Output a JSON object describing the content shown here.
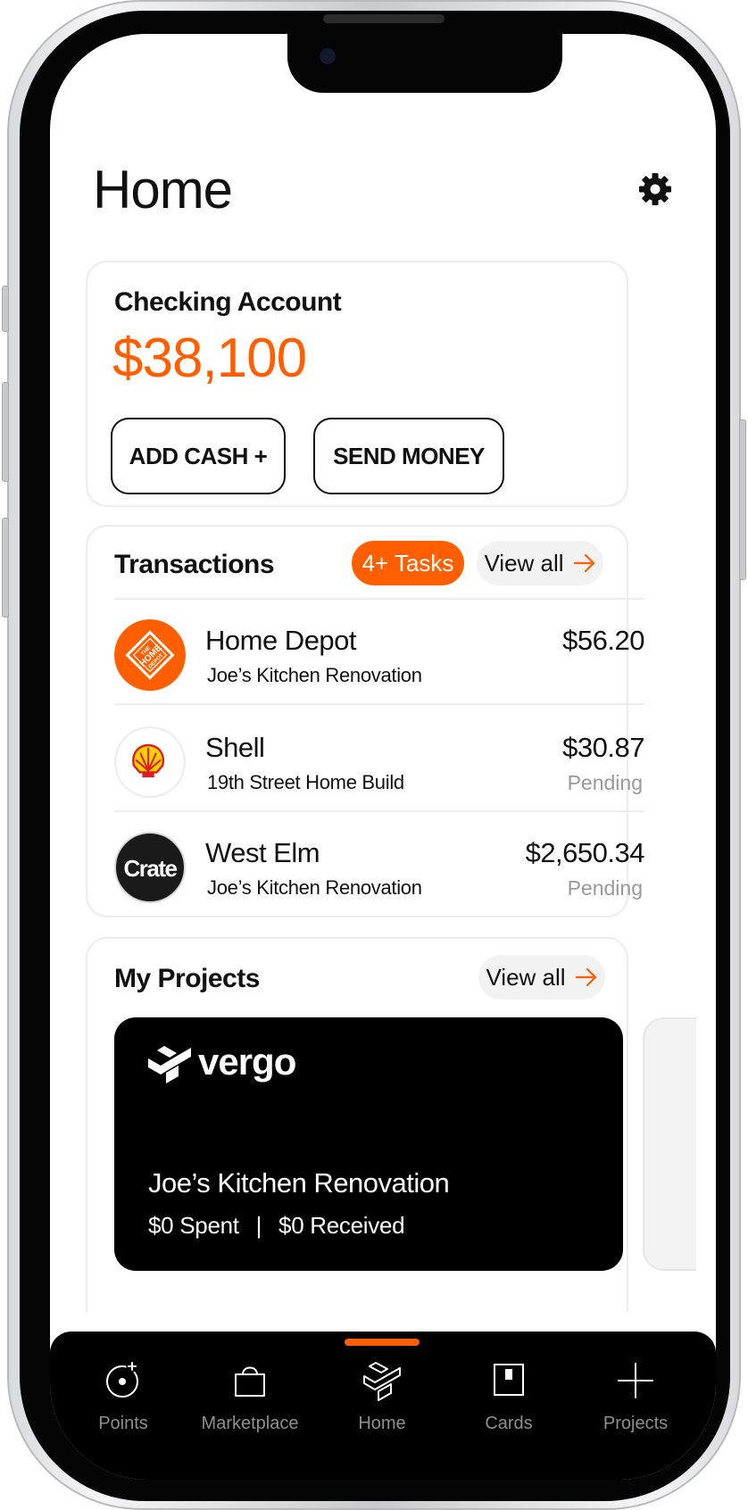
{
  "colors": {
    "accent": "#ff5f00",
    "text_primary": "#111111",
    "text_muted": "#999999",
    "card_border": "#ececec",
    "nav_bg": "#000000",
    "nav_label": "#8e8e8e"
  },
  "header": {
    "title": "Home",
    "settings_icon": "gear-icon"
  },
  "account": {
    "label": "Checking Account",
    "balance": "$38,100",
    "add_cash_label": "ADD CASH +",
    "send_money_label": "SEND MONEY"
  },
  "transactions": {
    "title": "Transactions",
    "tasks_badge": "4+ Tasks",
    "view_all": "View all",
    "items": [
      {
        "merchant": "Home Depot",
        "project": "Joe’s Kitchen Renovation",
        "amount": "$56.20",
        "status": "",
        "logo": "home-depot-logo",
        "logo_text": "THE HOME DEPOT"
      },
      {
        "merchant": "Shell",
        "project": "19th Street Home Build",
        "amount": "$30.87",
        "status": "Pending",
        "logo": "shell-logo"
      },
      {
        "merchant": "West Elm",
        "project": "Joe’s Kitchen Renovation",
        "amount": "$2,650.34",
        "status": "Pending",
        "logo": "crate-logo",
        "logo_text": "Crate"
      }
    ]
  },
  "projects": {
    "title": "My Projects",
    "view_all": "View all",
    "items": [
      {
        "brand": "vergo",
        "name": "Joe’s Kitchen Renovation",
        "spent": "$0 Spent",
        "received": "$0 Received"
      }
    ]
  },
  "nav": {
    "active_index": 2,
    "items": [
      {
        "label": "Points",
        "icon": "points-icon"
      },
      {
        "label": "Marketplace",
        "icon": "bag-icon"
      },
      {
        "label": "Home",
        "icon": "vergo-home-icon"
      },
      {
        "label": "Cards",
        "icon": "card-icon"
      },
      {
        "label": "Projects",
        "icon": "plus-icon"
      }
    ]
  }
}
